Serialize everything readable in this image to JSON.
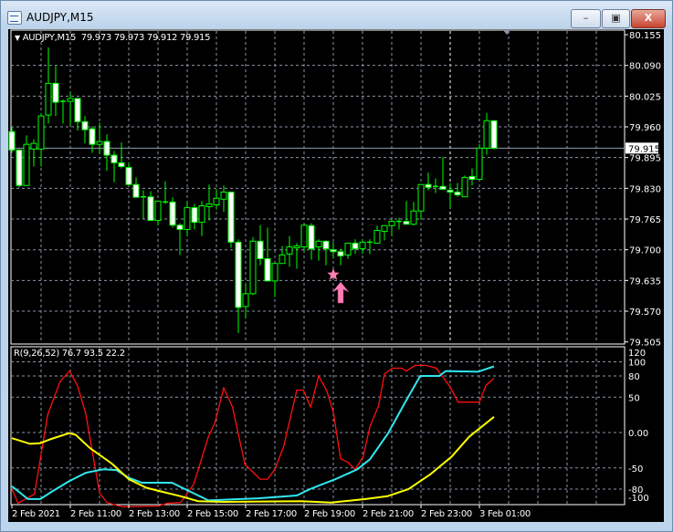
{
  "window": {
    "title": "AUDJPY,M15",
    "minimize": "–",
    "maximize": "▣",
    "close": "X"
  },
  "header": {
    "arrow": "▼",
    "symbol": "AUDJPY,M15",
    "ohlc": "79.973 79.973 79.912 79.915"
  },
  "indicator": {
    "label": "R(9,26,52) 76.7 93.5 22.2"
  },
  "colors": {
    "bull": "#00ff00",
    "bear_body": "#ffffff",
    "grid": "#8a96a8",
    "red": "#ff1010",
    "cyan": "#30e8f0",
    "yellow": "#ffff00",
    "marker": "#ff7eb6"
  },
  "chart_data": [
    {
      "type": "candlestick",
      "title": "AUDJPY,M15",
      "ylim": [
        79.505,
        80.155
      ],
      "price_ticks": [
        "80.155",
        "80.090",
        "80.025",
        "79.960",
        "79.895",
        "79.830",
        "79.765",
        "79.700",
        "79.635",
        "79.570",
        "79.505"
      ],
      "current_price": "79.915",
      "x_ticks": [
        "2 Feb 2021",
        "2 Feb 11:00",
        "2 Feb 13:00",
        "2 Feb 15:00",
        "2 Feb 17:00",
        "2 Feb 19:00",
        "2 Feb 21:00",
        "2 Feb 23:00",
        "3 Feb 01:00"
      ],
      "bars_per_tick": 8,
      "candles_ohlc": [
        [
          79.95,
          79.96,
          79.905,
          79.911
        ],
        [
          79.911,
          79.913,
          79.832,
          79.836
        ],
        [
          79.836,
          79.942,
          79.836,
          79.923
        ],
        [
          79.913,
          79.934,
          79.876,
          79.925
        ],
        [
          79.913,
          79.989,
          79.876,
          79.983
        ],
        [
          79.985,
          80.128,
          79.967,
          80.052
        ],
        [
          80.052,
          80.089,
          79.983,
          80.012
        ],
        [
          80.014,
          80.018,
          79.967,
          80.014
        ],
        [
          80.014,
          80.033,
          79.963,
          80.02
        ],
        [
          80.02,
          80.02,
          79.952,
          79.971
        ],
        [
          79.971,
          79.983,
          79.925,
          79.954
        ],
        [
          79.956,
          79.961,
          79.905,
          79.923
        ],
        [
          79.923,
          79.969,
          79.903,
          79.929
        ],
        [
          79.929,
          79.944,
          79.867,
          79.9
        ],
        [
          79.9,
          79.909,
          79.843,
          79.884
        ],
        [
          79.884,
          79.927,
          79.872,
          79.876
        ],
        [
          79.874,
          79.884,
          79.836,
          79.838
        ],
        [
          79.838,
          79.853,
          79.811,
          79.811
        ],
        [
          79.812,
          79.826,
          79.766,
          79.812
        ],
        [
          79.812,
          79.824,
          79.762,
          79.762
        ],
        [
          79.762,
          79.803,
          79.752,
          79.803
        ],
        [
          79.801,
          79.845,
          79.797,
          79.801
        ],
        [
          79.801,
          79.811,
          79.747,
          79.752
        ],
        [
          79.752,
          79.756,
          79.689,
          79.743
        ],
        [
          79.743,
          79.803,
          79.729,
          79.789
        ],
        [
          79.789,
          79.797,
          79.743,
          79.758
        ],
        [
          79.758,
          79.803,
          79.729,
          79.793
        ],
        [
          79.791,
          79.838,
          79.762,
          79.797
        ],
        [
          79.795,
          79.828,
          79.785,
          79.809
        ],
        [
          79.807,
          79.836,
          79.78,
          79.822
        ],
        [
          79.822,
          79.822,
          79.704,
          79.716
        ],
        [
          79.716,
          79.722,
          79.524,
          79.578
        ],
        [
          79.58,
          79.629,
          79.555,
          79.607
        ],
        [
          79.607,
          79.727,
          79.604,
          79.718
        ],
        [
          79.718,
          79.752,
          79.667,
          79.681
        ],
        [
          79.681,
          79.747,
          79.634,
          79.634
        ],
        [
          79.634,
          79.671,
          79.6,
          79.671
        ],
        [
          79.671,
          79.708,
          79.671,
          79.689
        ],
        [
          79.691,
          79.729,
          79.664,
          79.706
        ],
        [
          79.704,
          79.714,
          79.66,
          79.708
        ],
        [
          79.706,
          79.752,
          79.696,
          79.752
        ],
        [
          79.751,
          79.756,
          79.679,
          79.702
        ],
        [
          79.706,
          79.722,
          79.677,
          79.718
        ],
        [
          79.718,
          79.72,
          79.667,
          79.702
        ],
        [
          79.7,
          79.716,
          79.681,
          79.696
        ],
        [
          79.696,
          79.702,
          79.667,
          79.687
        ],
        [
          79.689,
          79.714,
          79.681,
          79.714
        ],
        [
          79.714,
          79.722,
          79.691,
          79.702
        ],
        [
          79.702,
          79.722,
          79.691,
          79.716
        ],
        [
          79.716,
          79.722,
          79.691,
          79.716
        ],
        [
          79.714,
          79.751,
          79.714,
          79.741
        ],
        [
          79.739,
          79.752,
          79.72,
          79.751
        ],
        [
          79.751,
          79.764,
          79.729,
          79.76
        ],
        [
          79.76,
          79.768,
          79.743,
          79.76
        ],
        [
          79.76,
          79.803,
          79.754,
          79.754
        ],
        [
          79.754,
          79.801,
          79.751,
          79.782
        ],
        [
          79.782,
          79.838,
          79.764,
          79.838
        ],
        [
          79.838,
          79.863,
          79.826,
          79.832
        ],
        [
          79.834,
          79.851,
          79.82,
          79.834
        ],
        [
          79.834,
          79.896,
          79.828,
          79.828
        ],
        [
          79.826,
          79.841,
          79.787,
          79.822
        ],
        [
          79.822,
          79.841,
          79.812,
          79.816
        ],
        [
          79.812,
          79.857,
          79.812,
          79.853
        ],
        [
          79.855,
          79.872,
          79.836,
          79.849
        ],
        [
          79.849,
          79.923,
          79.849,
          79.915
        ],
        [
          79.915,
          79.989,
          79.901,
          79.973
        ],
        [
          79.973,
          79.973,
          79.912,
          79.915
        ]
      ],
      "period_separator_bar": 60,
      "signal_markers": [
        {
          "type": "star",
          "bar": 44
        },
        {
          "type": "up-arrow",
          "bar": 45
        }
      ]
    },
    {
      "type": "line",
      "title": "R(9,26,52)",
      "ylim": [
        -100,
        120
      ],
      "y_ticks": [
        "120",
        "100",
        "80",
        "50",
        "0.00",
        "-50",
        "-80",
        "-100"
      ],
      "y_tick_values": [
        120,
        100,
        80,
        50,
        0,
        -50,
        -80,
        -100
      ],
      "series": [
        {
          "name": "R(9)",
          "color": "red",
          "last": "76.7",
          "points": [
            [
              0,
              -80
            ],
            [
              0.85,
              -100
            ],
            [
              3.1,
              -87
            ],
            [
              4.9,
              25
            ],
            [
              6.6,
              72
            ],
            [
              7.9,
              87
            ],
            [
              9,
              66
            ],
            [
              10.1,
              27
            ],
            [
              12,
              -85
            ],
            [
              13,
              -99
            ],
            [
              15.1,
              -105
            ],
            [
              20,
              -104
            ],
            [
              21.3,
              -100
            ],
            [
              23.1,
              -99
            ],
            [
              24.9,
              -73
            ],
            [
              26.9,
              -6
            ],
            [
              27.8,
              14
            ],
            [
              29,
              63
            ],
            [
              30.2,
              36
            ],
            [
              31.9,
              -45
            ],
            [
              34,
              -66
            ],
            [
              35,
              -66
            ],
            [
              36,
              -52
            ],
            [
              37.2,
              -20
            ],
            [
              39,
              60
            ],
            [
              39.9,
              60
            ],
            [
              40.9,
              36
            ],
            [
              42,
              80
            ],
            [
              43.1,
              59
            ],
            [
              44,
              29
            ],
            [
              45,
              -37
            ],
            [
              46,
              -42
            ],
            [
              47,
              -52
            ],
            [
              48.1,
              -34
            ],
            [
              49,
              8
            ],
            [
              50.2,
              38
            ],
            [
              51,
              83
            ],
            [
              52.1,
              91
            ],
            [
              53.4,
              91
            ],
            [
              54,
              87
            ],
            [
              55.2,
              95
            ],
            [
              56.7,
              95
            ],
            [
              58.1,
              91
            ],
            [
              59.9,
              66
            ],
            [
              61.1,
              43
            ],
            [
              64,
              43
            ],
            [
              64.9,
              67
            ],
            [
              66,
              76.7
            ]
          ]
        },
        {
          "name": "R(26)",
          "color": "cyan",
          "last": "93.5",
          "points": [
            [
              0,
              -76
            ],
            [
              2.2,
              -94
            ],
            [
              3.9,
              -94
            ],
            [
              5.4,
              -84
            ],
            [
              7.8,
              -69
            ],
            [
              10.1,
              -57
            ],
            [
              12.5,
              -52
            ],
            [
              14.3,
              -53
            ],
            [
              16,
              -64
            ],
            [
              17.8,
              -71
            ],
            [
              21.9,
              -71
            ],
            [
              23.7,
              -80
            ],
            [
              26.9,
              -96
            ],
            [
              33.7,
              -93
            ],
            [
              39,
              -89
            ],
            [
              40.8,
              -80
            ],
            [
              44.3,
              -66
            ],
            [
              47.3,
              -52
            ],
            [
              49,
              -38
            ],
            [
              51.5,
              -1
            ],
            [
              53.8,
              42
            ],
            [
              55.9,
              80
            ],
            [
              58.5,
              80
            ],
            [
              59.4,
              87
            ],
            [
              63.8,
              86
            ],
            [
              66,
              93.5
            ]
          ]
        },
        {
          "name": "R(52)",
          "color": "yellow",
          "last": "22.2",
          "points": [
            [
              0,
              -8
            ],
            [
              2.5,
              -16
            ],
            [
              3.9,
              -15
            ],
            [
              5.4,
              -9
            ],
            [
              7.8,
              -1
            ],
            [
              8.7,
              -3
            ],
            [
              10.7,
              -22
            ],
            [
              13.7,
              -44
            ],
            [
              16,
              -66
            ],
            [
              18.4,
              -78
            ],
            [
              20.7,
              -84
            ],
            [
              23.1,
              -90
            ],
            [
              25.5,
              -97
            ],
            [
              29,
              -98
            ],
            [
              39.6,
              -97
            ],
            [
              43.7,
              -99
            ],
            [
              48.4,
              -94
            ],
            [
              51.4,
              -90
            ],
            [
              54.3,
              -80
            ],
            [
              57.3,
              -59
            ],
            [
              60.2,
              -34
            ],
            [
              62.6,
              -6
            ],
            [
              66,
              22.2
            ]
          ]
        }
      ]
    }
  ]
}
